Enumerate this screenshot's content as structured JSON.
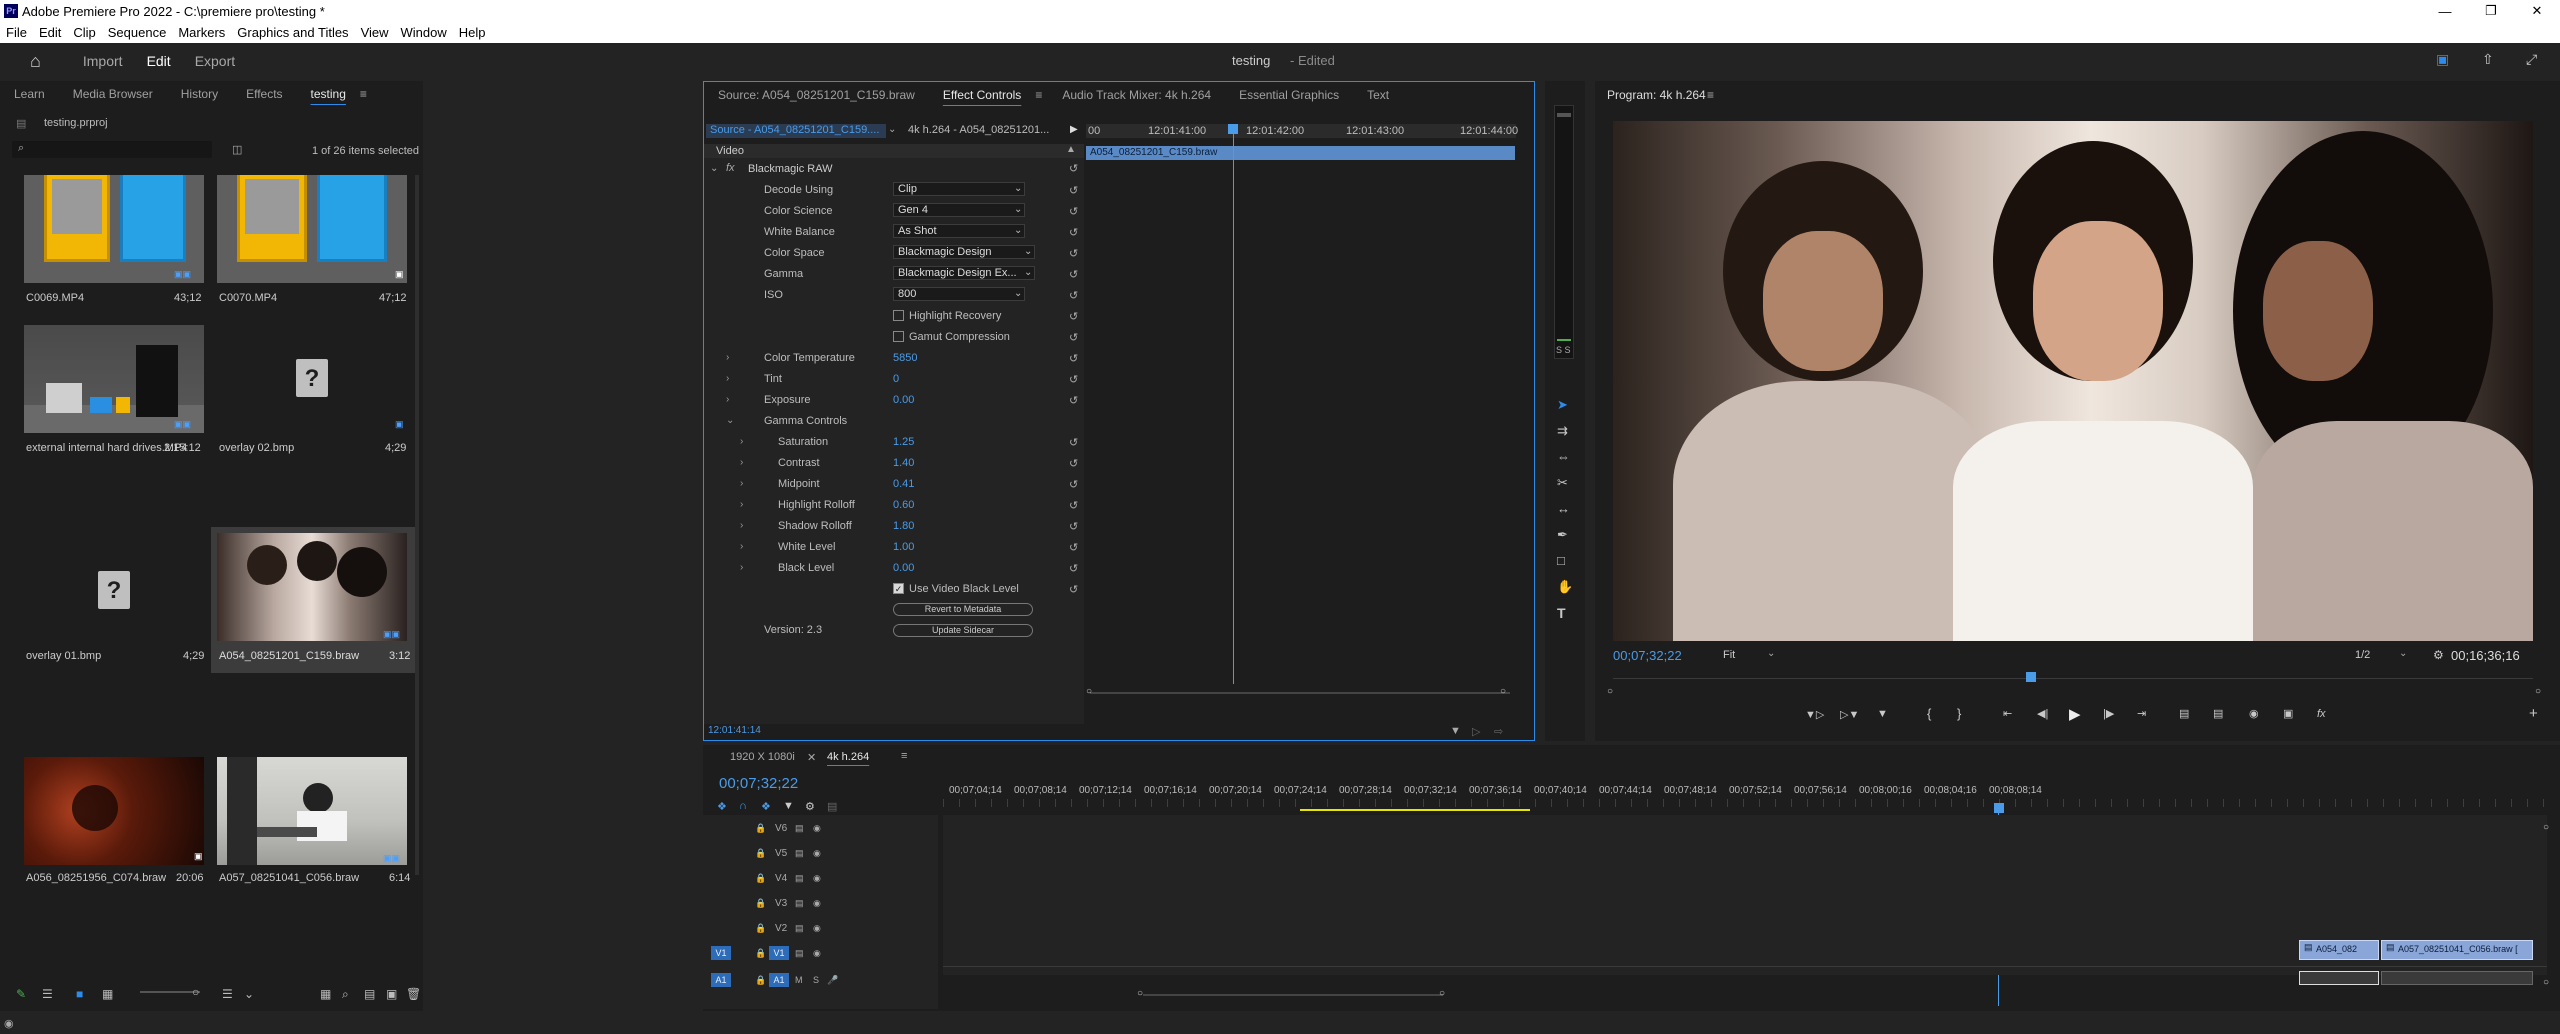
{
  "app": {
    "title": "Adobe Premiere Pro 2022 - C:\\premiere pro\\testing *",
    "logo": "Pr"
  },
  "menu": [
    "File",
    "Edit",
    "Clip",
    "Sequence",
    "Markers",
    "Graphics and Titles",
    "View",
    "Window",
    "Help"
  ],
  "workspace": {
    "tabs": [
      "Import",
      "Edit",
      "Export"
    ],
    "active": "Edit",
    "project_name": "testing",
    "edited_status": "- Edited"
  },
  "project_panel": {
    "tabs": [
      "Learn",
      "Media Browser",
      "History",
      "Effects",
      "testing"
    ],
    "active_tab": "testing",
    "file": "testing.prproj",
    "search_placeholder": "",
    "selection_status": "1 of 26 items selected",
    "items": [
      {
        "name": "C0069.MP4",
        "duration": "43;12"
      },
      {
        "name": "C0070.MP4",
        "duration": "47;12"
      },
      {
        "name": "external internal hard drives.MP4",
        "duration": "2:15:12"
      },
      {
        "name": "overlay 02.bmp",
        "duration": "4;29"
      },
      {
        "name": "overlay 01.bmp",
        "duration": "4;29"
      },
      {
        "name": "A054_08251201_C159.braw",
        "duration": "3:12"
      },
      {
        "name": "A056_08251956_C074.braw",
        "duration": "20:06"
      },
      {
        "name": "A057_08251041_C056.braw",
        "duration": "6:14"
      }
    ]
  },
  "source_panel": {
    "tabs": [
      "Source: A054_08251201_C159.braw",
      "Effect Controls",
      "Audio Track Mixer: 4k h.264",
      "Essential Graphics",
      "Text"
    ],
    "active_tab": "Effect Controls",
    "source_selector": "Source - A054_08251201_C159....",
    "sequence_selector": "4k h.264 - A054_08251201...",
    "timecodes": [
      "00",
      "12:01:41:00",
      "12:01:42:00",
      "12:01:43:00",
      "12:01:44:00"
    ],
    "clip_bar": "A054_08251201_C159.braw",
    "section": "Video",
    "effect": "Blackmagic RAW",
    "fx_label": "fx",
    "params": [
      {
        "label": "Decode Using",
        "select": "Clip"
      },
      {
        "label": "Color Science",
        "select": "Gen 4"
      },
      {
        "label": "White Balance",
        "select": "As Shot"
      },
      {
        "label": "Color Space",
        "select": "Blackmagic Design"
      },
      {
        "label": "Gamma",
        "select": "Blackmagic Design Ex..."
      },
      {
        "label": "ISO",
        "select": "800"
      }
    ],
    "checkboxes": [
      {
        "label": "Highlight Recovery",
        "checked": false
      },
      {
        "label": "Gamut Compression",
        "checked": false
      }
    ],
    "values": [
      {
        "label": "Color Temperature",
        "value": "5850"
      },
      {
        "label": "Tint",
        "value": "0"
      },
      {
        "label": "Exposure",
        "value": "0.00"
      }
    ],
    "gamma_controls": "Gamma Controls",
    "gamma_values": [
      {
        "label": "Saturation",
        "value": "1.25"
      },
      {
        "label": "Contrast",
        "value": "1.40"
      },
      {
        "label": "Midpoint",
        "value": "0.41"
      },
      {
        "label": "Highlight Rolloff",
        "value": "0.60"
      },
      {
        "label": "Shadow Rolloff",
        "value": "1.80"
      },
      {
        "label": "White Level",
        "value": "1.00"
      },
      {
        "label": "Black Level",
        "value": "0.00"
      }
    ],
    "use_video_black": "Use Video Black Level",
    "use_video_black_checked": true,
    "revert_btn": "Revert to Metadata",
    "version": "Version: 2.3",
    "update_btn": "Update Sidecar",
    "current_time": "12:01:41:14"
  },
  "program_monitor": {
    "title": "Program: 4k h.264",
    "timecode": "00;07;32;22",
    "fit": "Fit",
    "resolution": "1/2",
    "duration": "00;16;36;16"
  },
  "timeline": {
    "tabs": [
      "1920 X 1080i",
      "4k h.264"
    ],
    "active_tab": "4k h.264",
    "timecode": "00;07;32;22",
    "ruler": [
      "00;07;04;14",
      "00;07;08;14",
      "00;07;12;14",
      "00;07;16;14",
      "00;07;20;14",
      "00;07;24;14",
      "00;07;28;14",
      "00;07;32;14",
      "00;07;36;14",
      "00;07;40;14",
      "00;07;44;14",
      "00;07;48;14",
      "00;07;52;14",
      "00;07;56;14",
      "00;08;00;16",
      "00;08;04;16",
      "00;08;08;14"
    ],
    "video_tracks": [
      "V6",
      "V5",
      "V4",
      "V3",
      "V2",
      "V1"
    ],
    "audio_tracks": [
      "A1"
    ],
    "src_patch_v": "V1",
    "src_patch_a": "A1",
    "clips": [
      {
        "name": "A054_082",
        "track": "V1"
      },
      {
        "name": "A057_08251041_C056.braw [",
        "track": "V1"
      }
    ],
    "mute": "M",
    "solo": "S"
  },
  "colors": {
    "accent": "#2d8ceb",
    "panel_bg": "#1d1d1d",
    "app_bg": "#232323",
    "clip_blue": "#8aa5d8",
    "work_area": "#e5e500"
  }
}
